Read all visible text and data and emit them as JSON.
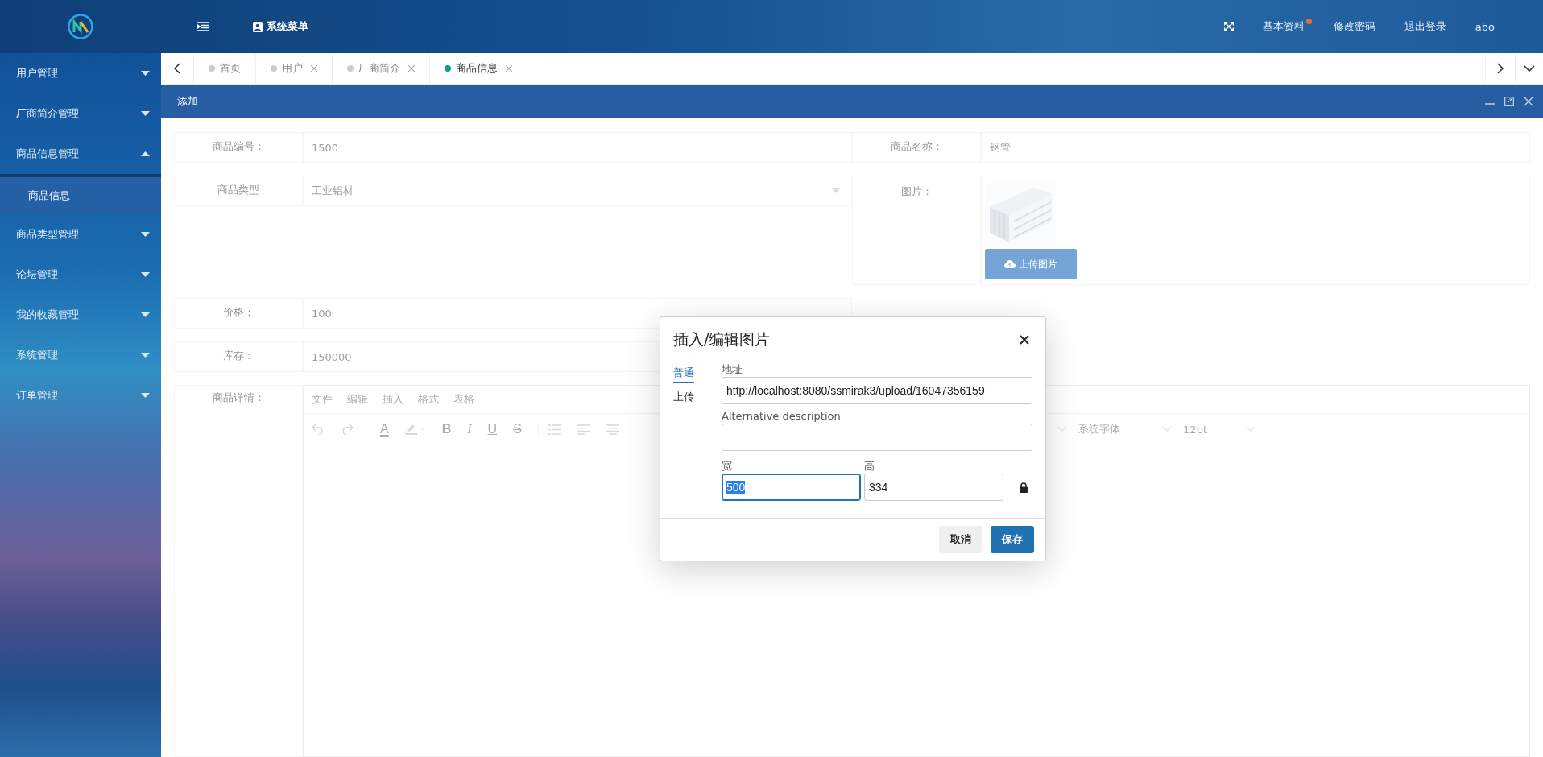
{
  "header": {
    "menu_title": "系统菜单",
    "links": [
      {
        "label": "基本资料",
        "badge": true
      },
      {
        "label": "修改密码",
        "badge": false
      },
      {
        "label": "退出登录",
        "badge": false
      }
    ],
    "user": "abo"
  },
  "sidebar": {
    "items": [
      {
        "label": "用户管理",
        "expanded": false
      },
      {
        "label": "厂商简介管理",
        "expanded": false
      },
      {
        "label": "商品信息管理",
        "expanded": true,
        "children": [
          {
            "label": "商品信息",
            "selected": true
          }
        ]
      },
      {
        "label": "商品类型管理",
        "expanded": false
      },
      {
        "label": "论坛管理",
        "expanded": false
      },
      {
        "label": "我的收藏管理",
        "expanded": false
      },
      {
        "label": "系统管理",
        "expanded": false
      },
      {
        "label": "订单管理",
        "expanded": false
      }
    ]
  },
  "tabs": [
    {
      "label": "首页",
      "selected": false,
      "closable": false
    },
    {
      "label": "用户",
      "selected": false,
      "closable": true
    },
    {
      "label": "厂商简介",
      "selected": false,
      "closable": true
    },
    {
      "label": "商品信息",
      "selected": true,
      "closable": true
    }
  ],
  "panel": {
    "title": "添加"
  },
  "form": {
    "rows": [
      {
        "fields": [
          {
            "kind": "text",
            "label": "商品编号：",
            "value": "1500"
          },
          {
            "kind": "text",
            "label": "商品名称：",
            "value": "钢管"
          }
        ]
      },
      {
        "fields": [
          {
            "kind": "select",
            "label": "商品类型",
            "value": "工业铝材"
          },
          {
            "label": "图片：",
            "button": "上传图片"
          }
        ]
      },
      {
        "fields": [
          {
            "kind": "text",
            "label": "价格：",
            "value": "100"
          }
        ]
      },
      {
        "fields": [
          {
            "kind": "text",
            "label": "库存：",
            "value": "150000"
          }
        ]
      },
      {
        "fields": [
          {
            "kind": "editor",
            "label": "商品详情："
          }
        ]
      }
    ]
  },
  "editor": {
    "menus": [
      "文件",
      "编辑",
      "插入",
      "格式",
      "表格"
    ],
    "tools": [
      {
        "kind": "undo"
      },
      {
        "kind": "redo"
      },
      {
        "kind": "fontcolor",
        "label": "A"
      },
      {
        "kind": "highlight"
      },
      {
        "kind": "bold",
        "label": "B"
      },
      {
        "kind": "italic",
        "label": "I"
      },
      {
        "kind": "underline",
        "label": "U"
      },
      {
        "kind": "strike",
        "label": "S"
      },
      {
        "kind": "list"
      },
      {
        "kind": "align-left"
      },
      {
        "kind": "align-center"
      }
    ],
    "font_family": "系统字体",
    "font_size": "12pt"
  },
  "dialog": {
    "title": "插入/编辑图片",
    "tabs": [
      {
        "label": "普通",
        "selected": true
      },
      {
        "label": "上传",
        "selected": false
      }
    ],
    "url_label": "地址",
    "url": "http://localhost:8080/ssmirak3/upload/16047356159",
    "alt_label": "Alternative description",
    "dims": [
      {
        "label": "宽",
        "value": "500",
        "focused": true
      },
      {
        "label": "高",
        "value": "334",
        "focused": false
      }
    ],
    "buttons": [
      {
        "label": "取消",
        "kind": "secondary"
      },
      {
        "label": "保存",
        "kind": "primary"
      }
    ]
  }
}
